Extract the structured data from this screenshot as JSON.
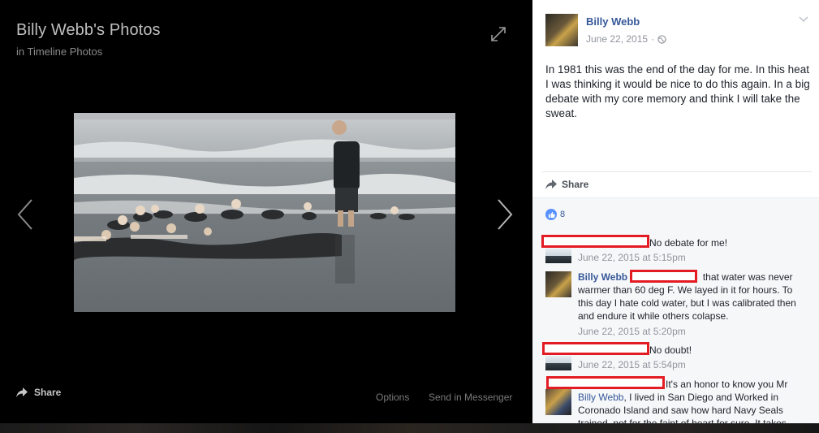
{
  "viewer": {
    "title": "Billy Webb's Photos",
    "subtitle": "in Timeline Photos",
    "share_label": "Share",
    "options_label": "Options",
    "messenger_label": "Send in Messenger"
  },
  "post": {
    "author": "Billy Webb",
    "date": "June 22, 2015",
    "separator": "·",
    "text": "In 1981 this was the end of the day for me. In this heat I was thinking it would be nice to do this again. In a big debate with my core memory and think I will take the sweat.",
    "share_label": "Share",
    "like_count": "8"
  },
  "comments": [
    {
      "author": "",
      "text": "No debate for me!",
      "time": "June 22, 2015 at 5:15pm"
    },
    {
      "author": "Billy Webb",
      "text": "that water was never warmer than 60 deg F. We layed in it for hours. To this day I hate cold water, but I was calibrated then and endure it while others colapse.",
      "time": "June 22, 2015 at 5:20pm"
    },
    {
      "author": "",
      "text": "No doubt!",
      "time": "June 22, 2015 at 5:54pm"
    },
    {
      "author": "",
      "text_before": "It's an honor to know you Mr",
      "mention": "Billy Webb",
      "text_after": ", I lived in San Diego and Worked in Coronado Island and saw how hard Navy Seals trained, not for the faint of heart for sure. It takes"
    }
  ],
  "colors": {
    "link": "#365899",
    "redaction": "#e31b23",
    "like": "#5890ff"
  },
  "icons": [
    "expand-icon",
    "chevron-left-icon",
    "chevron-right-icon",
    "share-arrow-icon",
    "globe-icon",
    "chevron-down-icon",
    "like-icon"
  ]
}
